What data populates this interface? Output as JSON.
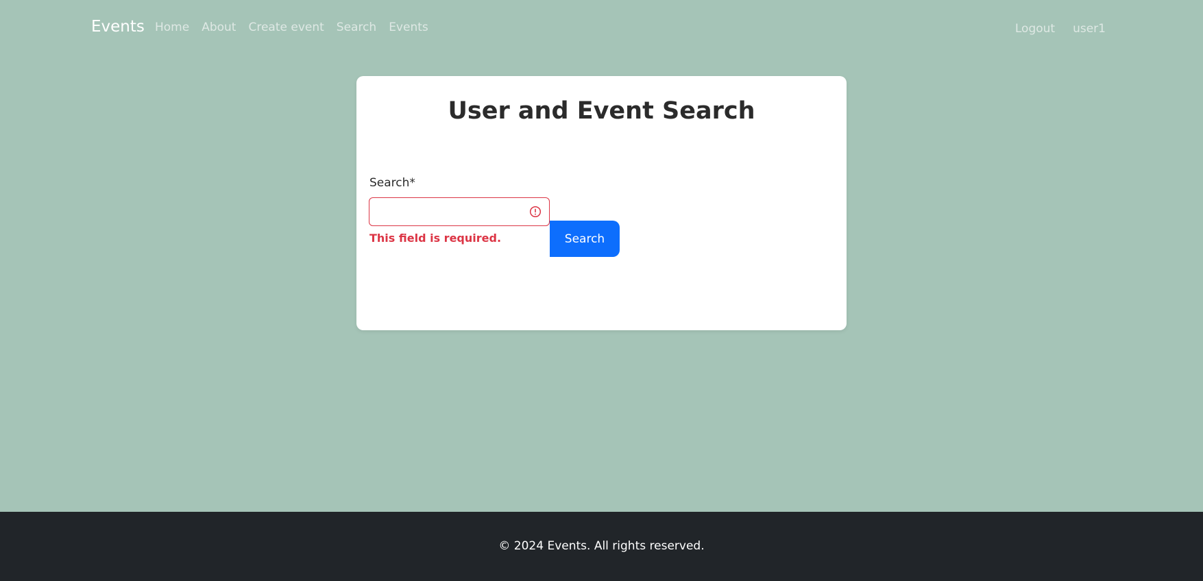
{
  "navbar": {
    "brand": "Events",
    "links": [
      "Home",
      "About",
      "Create event",
      "Search",
      "Events"
    ],
    "right_links": [
      "Logout",
      "user1"
    ]
  },
  "card": {
    "title": "User and Event Search",
    "form": {
      "label": "Search*",
      "input_value": "",
      "error": "This field is required.",
      "button_label": "Search",
      "error_icon": "alert-circle-icon"
    }
  },
  "footer": {
    "text": "© 2024 Events. All rights reserved."
  },
  "colors": {
    "background": "#a5c4b7",
    "primary": "#0d6efd",
    "danger": "#dc3545",
    "footer": "#212529"
  }
}
